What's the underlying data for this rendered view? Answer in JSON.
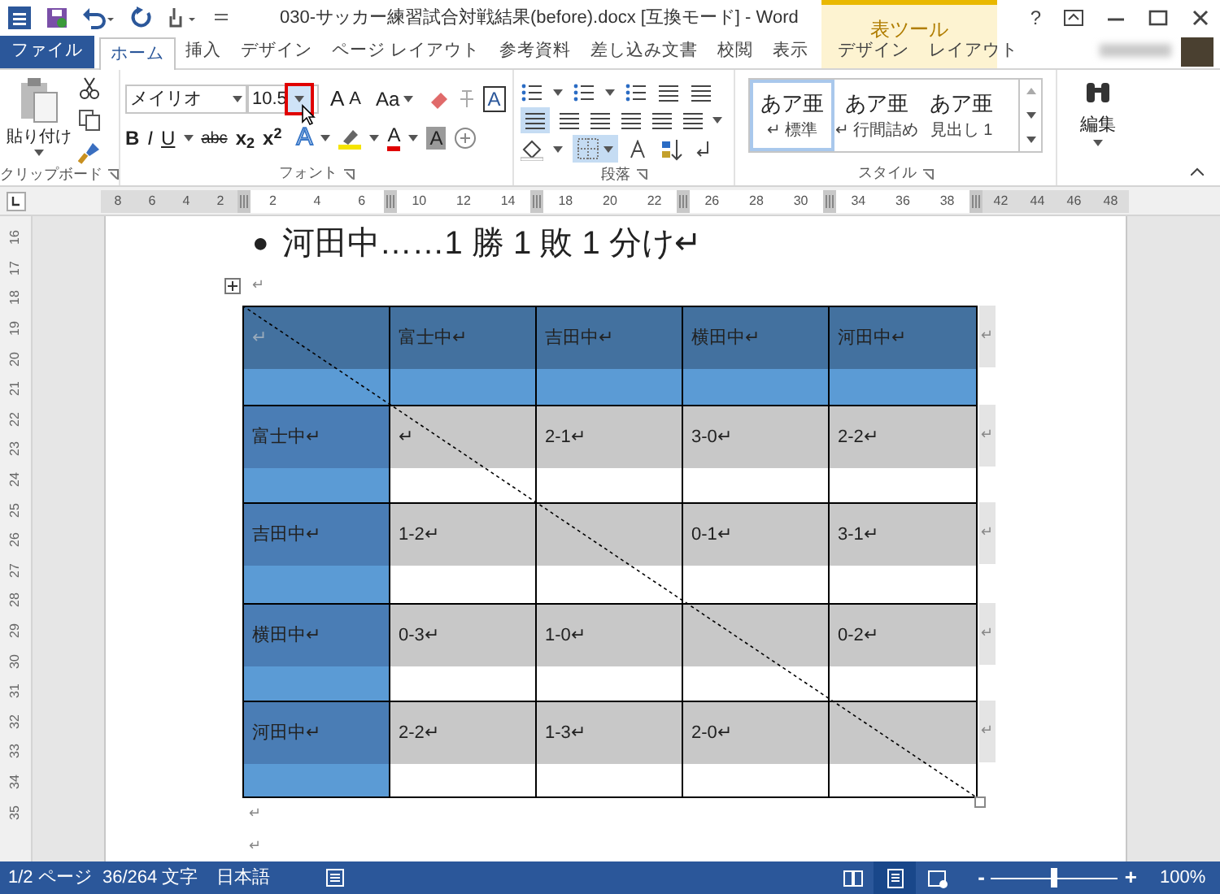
{
  "window": {
    "title": "030-サッカー練習試合対戦結果(before).docx [互換モード] - Word",
    "context_group": "表ツール",
    "help": "?"
  },
  "tabs": [
    {
      "label": "ファイル",
      "kind": "file",
      "selected": false
    },
    {
      "label": "ホーム",
      "kind": "normal",
      "selected": true
    },
    {
      "label": "挿入",
      "kind": "normal",
      "selected": false
    },
    {
      "label": "デザイン",
      "kind": "normal",
      "selected": false
    },
    {
      "label": "ページ レイアウト",
      "kind": "normal",
      "selected": false
    },
    {
      "label": "参考資料",
      "kind": "normal",
      "selected": false
    },
    {
      "label": "差し込み文書",
      "kind": "normal",
      "selected": false
    },
    {
      "label": "校閲",
      "kind": "normal",
      "selected": false
    },
    {
      "label": "表示",
      "kind": "normal",
      "selected": false
    },
    {
      "label": "デザイン",
      "kind": "context",
      "selected": false
    },
    {
      "label": "レイアウト",
      "kind": "context",
      "selected": false
    }
  ],
  "ribbon": {
    "clipboard": {
      "paste_label": "貼り付け",
      "group_label": "クリップボード"
    },
    "font": {
      "font_name": "メイリオ",
      "font_size": "10.5",
      "size_dropdown_highlighted": true,
      "grow": "A",
      "shrink": "A",
      "change_case": "Aa",
      "char_border": "A",
      "bold": "B",
      "italic": "I",
      "underline": "U",
      "strikethrough": "abc",
      "subscript": "x$_{2}$",
      "superscript": "x$^{2}$",
      "text_effect": "A",
      "font_color": "A",
      "char_shading": "A",
      "group_label": "フォント"
    },
    "paragraph": {
      "group_label": "段落"
    },
    "styles": {
      "items": [
        {
          "sample": "あア亜",
          "label": "↵ 標準",
          "selected": true
        },
        {
          "sample": "あア亜",
          "label": "↵ 行間詰め",
          "selected": false
        },
        {
          "sample": "あア亜",
          "label": "見出し 1",
          "selected": false
        }
      ],
      "group_label": "スタイル"
    },
    "editing": {
      "label": "編集"
    }
  },
  "ruler": {
    "segments": [
      [
        "8",
        "6",
        "4",
        "2"
      ],
      [
        "2",
        "4",
        "6"
      ],
      [
        "10",
        "12",
        "14"
      ],
      [
        "18",
        "20",
        "22"
      ],
      [
        "26",
        "28",
        "30"
      ],
      [
        "34",
        "36",
        "38"
      ],
      [
        "42",
        "44",
        "46",
        "48"
      ]
    ]
  },
  "vertical_ruler": [
    "16",
    "17",
    "18",
    "19",
    "20",
    "21",
    "22",
    "23",
    "24",
    "25",
    "26",
    "27",
    "28",
    "29",
    "30",
    "31",
    "32",
    "33",
    "34",
    "35"
  ],
  "document": {
    "bullet": "●",
    "heading": "河田中……1 勝 1 敗 1 分け↵",
    "table_mark": "↵",
    "table": {
      "rows": [
        {
          "end_mark": "↵",
          "cells": [
            {
              "kind": "corner",
              "text": "↵"
            },
            {
              "kind": "header",
              "text": "富士中↵"
            },
            {
              "kind": "header",
              "text": "吉田中↵"
            },
            {
              "kind": "header",
              "text": "横田中↵"
            },
            {
              "kind": "header",
              "text": "河田中↵"
            }
          ]
        },
        {
          "end_mark": "↵",
          "cells": [
            {
              "kind": "rowhead",
              "text": "富士中↵"
            },
            {
              "kind": "data",
              "text": "↵"
            },
            {
              "kind": "data",
              "text": "2-1↵"
            },
            {
              "kind": "data",
              "text": "3-0↵"
            },
            {
              "kind": "data",
              "text": "2-2↵"
            }
          ]
        },
        {
          "end_mark": "↵",
          "cells": [
            {
              "kind": "rowhead",
              "text": "吉田中↵"
            },
            {
              "kind": "data",
              "text": "1-2↵"
            },
            {
              "kind": "data"
            },
            {
              "kind": "data",
              "text": "0-1↵"
            },
            {
              "kind": "data",
              "text": "3-1↵"
            }
          ]
        },
        {
          "end_mark": "↵",
          "cells": [
            {
              "kind": "rowhead",
              "text": "横田中↵"
            },
            {
              "kind": "data",
              "text": "0-3↵"
            },
            {
              "kind": "data",
              "text": "1-0↵"
            },
            {
              "kind": "data"
            },
            {
              "kind": "data",
              "text": "0-2↵"
            }
          ]
        },
        {
          "end_mark": "↵",
          "cells": [
            {
              "kind": "rowhead",
              "text": "河田中↵"
            },
            {
              "kind": "data",
              "text": "2-2↵"
            },
            {
              "kind": "data",
              "text": "1-3↵"
            },
            {
              "kind": "data",
              "text": "2-0↵"
            },
            {
              "kind": "data"
            }
          ]
        }
      ]
    },
    "after_table": [
      "↵",
      "↵"
    ]
  },
  "status_bar": {
    "page": "1/2 ページ",
    "words": "36/264 文字",
    "language": "日本語",
    "views": [
      {
        "kind": "read",
        "selected": false
      },
      {
        "kind": "print",
        "selected": true
      },
      {
        "kind": "web",
        "selected": false
      }
    ],
    "zoom_out": "-",
    "zoom_in": "+",
    "zoom": {
      "level": 0.5,
      "reading": "100%"
    }
  }
}
